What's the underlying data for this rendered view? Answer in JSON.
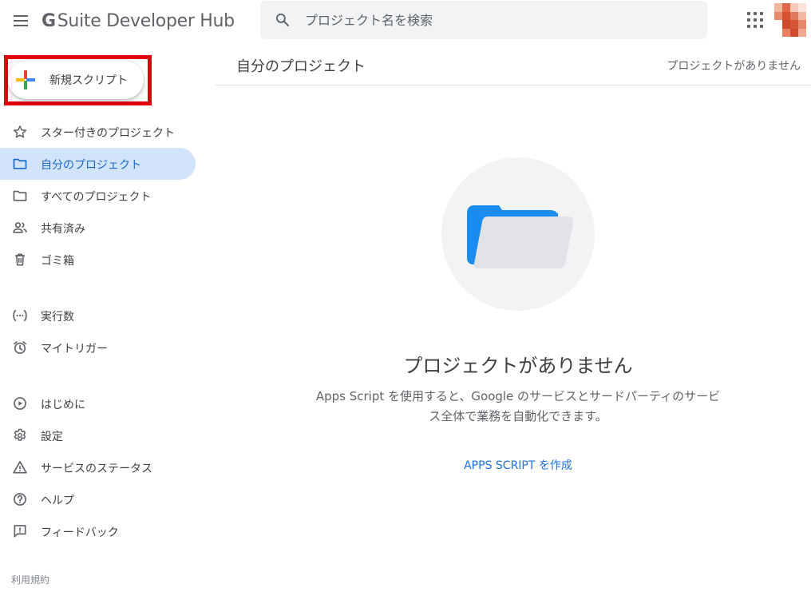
{
  "app": {
    "title": "G Suite Developer Hub",
    "logo_letter": "G",
    "logo_text": "Suite Developer Hub"
  },
  "search": {
    "placeholder": "プロジェクト名を検索"
  },
  "sidebar": {
    "new_script_label": "新規スクリプト",
    "items": [
      {
        "label": "スター付きのプロジェクト",
        "icon": "star-icon"
      },
      {
        "label": "自分のプロジェクト",
        "icon": "folder-icon",
        "active": true
      },
      {
        "label": "すべてのプロジェクト",
        "icon": "folder-icon"
      },
      {
        "label": "共有済み",
        "icon": "people-icon"
      },
      {
        "label": "ゴミ箱",
        "icon": "trash-icon"
      },
      {
        "label": "実行数",
        "icon": "executions-icon"
      },
      {
        "label": "マイトリガー",
        "icon": "alarm-icon"
      },
      {
        "label": "はじめに",
        "icon": "play-circle-icon"
      },
      {
        "label": "設定",
        "icon": "gear-icon"
      },
      {
        "label": "サービスのステータス",
        "icon": "warning-icon"
      },
      {
        "label": "ヘルプ",
        "icon": "help-icon"
      },
      {
        "label": "フィードバック",
        "icon": "feedback-icon"
      }
    ],
    "terms_label": "利用規約"
  },
  "main": {
    "title": "自分のプロジェクト",
    "status": "プロジェクトがありません",
    "empty_title": "プロジェクトがありません",
    "empty_description": "Apps Script を使用すると、Google のサービスとサードパーティのサービス全体で業務を自動化できます。",
    "create_link": "APPS SCRIPT を作成"
  },
  "colors": {
    "accent": "#1a73e8",
    "active_bg": "#d2e3fc",
    "highlight_border": "#e0000b",
    "folder_blue": "#1a8cf0"
  }
}
